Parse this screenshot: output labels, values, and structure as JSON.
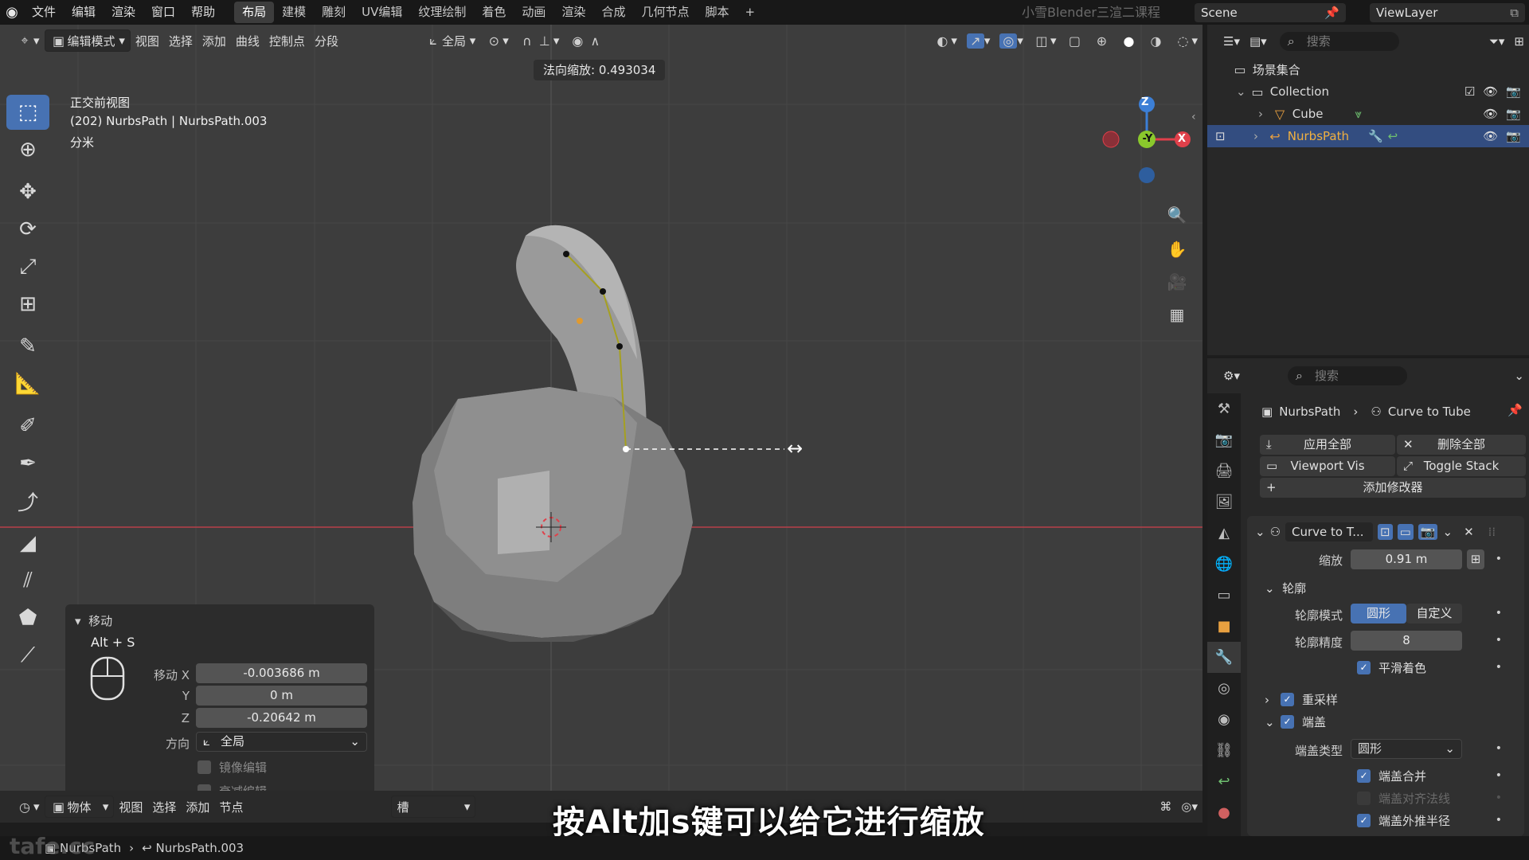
{
  "topbar": {
    "menus": [
      "文件",
      "编辑",
      "渲染",
      "窗口",
      "帮助"
    ],
    "workspaces": [
      "布局",
      "建模",
      "雕刻",
      "UV编辑",
      "纹理绘制",
      "着色",
      "动画",
      "渲染",
      "合成",
      "几何节点",
      "脚本"
    ],
    "active_workspace": "布局",
    "add_label": "+",
    "watermark": "小雪Blender三渲二课程",
    "scene": "Scene",
    "view_layer": "ViewLayer"
  },
  "viewport": {
    "header": {
      "mode": "编辑模式",
      "menus": [
        "视图",
        "选择",
        "添加",
        "曲线",
        "控制点",
        "分段"
      ],
      "orientation": "全局"
    },
    "hud_text": "法向缩放: 0.493034",
    "info": {
      "view_name": "正交前视图",
      "object": "(202) NurbsPath | NurbsPath.003",
      "units": "分米"
    },
    "gizmo": {
      "z": "Z",
      "y": "-Y",
      "x": "X"
    },
    "colors": {
      "x_axis": "#e0404a",
      "y_axis": "#8ac82c",
      "z_axis": "#3c7fd6",
      "selection": "#4772b3"
    }
  },
  "operator_panel": {
    "title": "移动",
    "shortcut": "Alt + S",
    "move_x_label": "移动 X",
    "move_x": "-0.003686 m",
    "y_label": "Y",
    "move_y": "0 m",
    "z_label": "Z",
    "move_z": "-0.20642 m",
    "orientation_label": "方向",
    "orientation": "全局",
    "mirror_edit": "镜像编辑",
    "proportional_edit": "衰减编辑"
  },
  "bottom_bar": {
    "editor_mode": "物体",
    "menus": [
      "视图",
      "选择",
      "添加",
      "节点"
    ],
    "slot": "槽"
  },
  "subtitle": "按Alt加s键可以给它进行缩放",
  "status_bar": {
    "watermark": "tafe.cc",
    "breadcrumb_1": "NurbsPath",
    "breadcrumb_2": "NurbsPath.003"
  },
  "outliner": {
    "search_placeholder": "搜索",
    "scene_collection": "场景集合",
    "collection": "Collection",
    "items": [
      {
        "name": "Cube"
      },
      {
        "name": "NurbsPath"
      }
    ]
  },
  "properties": {
    "search_placeholder": "搜索",
    "breadcrumb_object": "NurbsPath",
    "breadcrumb_modifier": "Curve to Tube",
    "apply_all": "应用全部",
    "delete_all": "删除全部",
    "viewport_vis": "Viewport Vis",
    "toggle_stack": "Toggle Stack",
    "add_modifier": "添加修改器",
    "modifier": {
      "name": "Curve to T...",
      "scale_label": "缩放",
      "scale": "0.91 m",
      "profile_section": "轮廓",
      "profile_mode_label": "轮廓模式",
      "profile_mode_options": [
        "圆形",
        "自定义"
      ],
      "profile_resolution_label": "轮廓精度",
      "profile_resolution": "8",
      "smooth_shading": "平滑着色",
      "resample": "重采样",
      "caps": "端盖",
      "cap_type_label": "端盖类型",
      "cap_type": "圆形",
      "cap_merge": "端盖合并",
      "cap_align_normals": "端盖对齐法线",
      "cap_outer_radius": "端盖外推半径"
    }
  }
}
